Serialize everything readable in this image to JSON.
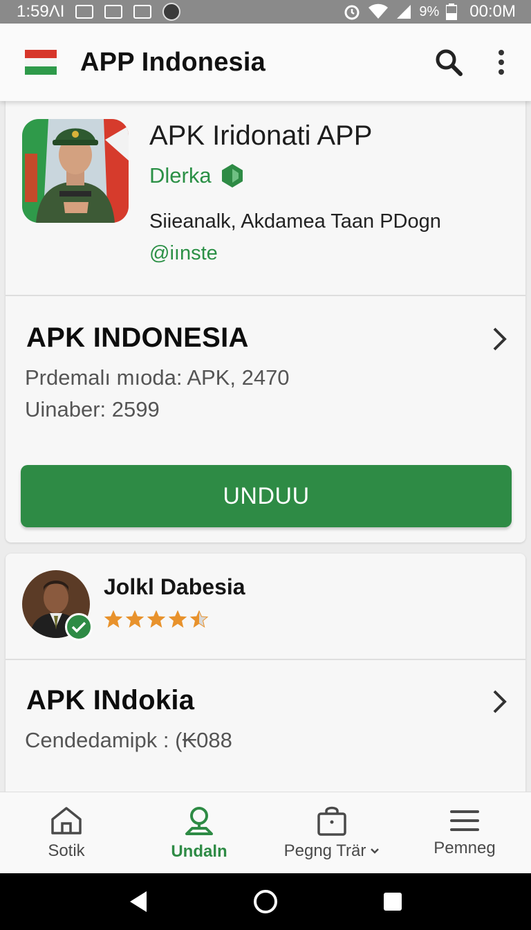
{
  "status_bar": {
    "time": "1:59ΛI",
    "battery_percent": "9%",
    "clock_right": "00:0M"
  },
  "app_bar": {
    "title": "APP Indonesia",
    "search_icon": "search-icon",
    "menu_icon": "more-vert-icon"
  },
  "app": {
    "name": "APK Iridonati APP",
    "developer": "Dlerka",
    "subtitle": "Siieanalk, Akdamea Taan PDogn",
    "handle": "@iınste"
  },
  "detail1": {
    "title": "APK INDONESIA",
    "line1": "Prdemalı mıoda:  APK, 2470",
    "line2": "Uinaber:  2599"
  },
  "download_button": "UNDUU",
  "review": {
    "name": "Jolkl Dabesia",
    "rating": 4.5,
    "max_rating": 5
  },
  "detail2": {
    "title": "APK INdokia",
    "line1": "Cendedamipk :  (₭088"
  },
  "bottom_nav": {
    "items": [
      {
        "label": "Sotik",
        "icon": "home-icon"
      },
      {
        "label": "Undaln",
        "icon": "location-pin-icon",
        "active": true
      },
      {
        "label": "Pegng Trär",
        "icon": "shopping-bag-icon"
      },
      {
        "label": "Pemneg",
        "icon": "hamburger-menu-icon"
      }
    ]
  },
  "colors": {
    "accent_green": "#2e8b45",
    "status_bar": "#8a8a8a",
    "star": "#e8922c"
  }
}
